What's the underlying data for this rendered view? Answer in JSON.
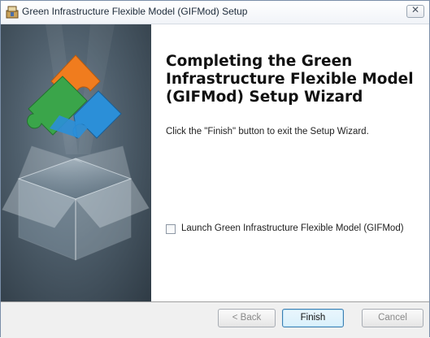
{
  "window": {
    "title": "Green Infrastructure Flexible Model (GIFMod) Setup",
    "title_icon": "installer-icon",
    "close_glyph": "✕"
  },
  "main": {
    "heading": "Completing the Green Infrastructure Flexible Model (GIFMod) Setup Wizard",
    "body": "Click the \"Finish\" button to exit the Setup Wizard.",
    "launch_checkbox": {
      "label": "Launch Green Infrastructure Flexible Model (GIFMod)",
      "checked": false
    }
  },
  "buttons": {
    "back": "< Back",
    "finish": "Finish",
    "cancel": "Cancel"
  },
  "colors": {
    "banner_dark": "#2f3b45",
    "puzzle_orange": "#f07c1e",
    "puzzle_green": "#3aa54a",
    "puzzle_blue": "#2b8fd8",
    "default_button_border": "#3c7fb1"
  }
}
